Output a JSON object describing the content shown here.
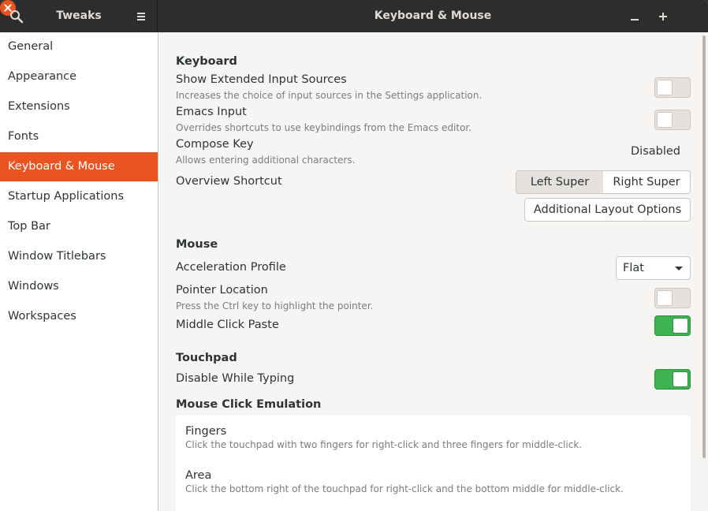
{
  "window": {
    "title": "Keyboard & Mouse",
    "app_title": "Tweaks"
  },
  "sidebar": {
    "items": [
      {
        "label": "General"
      },
      {
        "label": "Appearance"
      },
      {
        "label": "Extensions"
      },
      {
        "label": "Fonts"
      },
      {
        "label": "Keyboard & Mouse",
        "active": true
      },
      {
        "label": "Startup Applications"
      },
      {
        "label": "Top Bar"
      },
      {
        "label": "Window Titlebars"
      },
      {
        "label": "Windows"
      },
      {
        "label": "Workspaces"
      }
    ]
  },
  "keyboard": {
    "title": "Keyboard",
    "extended_input": {
      "label": "Show Extended Input Sources",
      "desc": "Increases the choice of input sources in the Settings application.",
      "enabled": false
    },
    "emacs": {
      "label": "Emacs Input",
      "desc": "Overrides shortcuts to use keybindings from the Emacs editor.",
      "enabled": false
    },
    "compose": {
      "label": "Compose Key",
      "desc": "Allows entering additional characters.",
      "value": "Disabled"
    },
    "overview": {
      "label": "Overview Shortcut",
      "options": [
        "Left Super",
        "Right Super"
      ],
      "selected": "Left Super"
    },
    "layout_button": "Additional Layout Options"
  },
  "mouse": {
    "title": "Mouse",
    "acceleration": {
      "label": "Acceleration Profile",
      "value": "Flat"
    },
    "pointer_location": {
      "label": "Pointer Location",
      "desc": "Press the Ctrl key to highlight the pointer.",
      "enabled": false
    },
    "middle_click": {
      "label": "Middle Click Paste",
      "enabled": true
    }
  },
  "touchpad": {
    "title": "Touchpad",
    "disable_typing": {
      "label": "Disable While Typing",
      "enabled": true
    },
    "emulation_title": "Mouse Click Emulation",
    "emulation_options": [
      {
        "label": "Fingers",
        "desc": "Click the touchpad with two fingers for right-click and three fingers for middle-click."
      },
      {
        "label": "Area",
        "desc": "Click the bottom right of the touchpad for right-click and the bottom middle for middle-click."
      }
    ]
  },
  "colors": {
    "accent": "#e95420",
    "switch_on": "#3eb34f",
    "headerbar": "#2d2d2d"
  }
}
